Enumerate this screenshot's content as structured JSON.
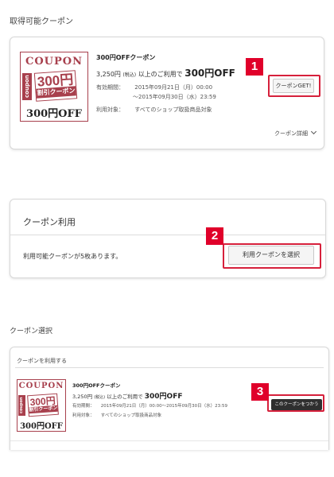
{
  "section1": {
    "title": "取得可能クーポン",
    "coupon": {
      "image": {
        "head": "COUPON",
        "side_tab": "coupon",
        "amount": "300円",
        "label": "割引クーポン",
        "foot": "300円OFF"
      },
      "name": "300円OFFクーポン",
      "condition_amount": "3,250円",
      "condition_tax": "(税込)",
      "condition_mid": "以上のご利用で",
      "condition_discount": "300円OFF",
      "period_label": "有効期間：",
      "period_start": "2015年09月21日（月）00:00",
      "period_end": "〜2015年09月30日（水）23:59",
      "target_label": "利用対象：",
      "target_value": "すべてのショップ取扱商品対象",
      "get_button": "クーポンGET!",
      "details_link": "クーポン詳細"
    },
    "step_badge": "1"
  },
  "section2": {
    "title": "クーポン利用",
    "available_text": "利用可能クーポンが5枚あります。",
    "select_button": "利用クーポンを選択",
    "step_badge": "2"
  },
  "section3": {
    "title": "クーポン選択",
    "subtitle": "クーポンを利用する",
    "coupon": {
      "image": {
        "head": "COUPON",
        "side_tab": "coupon",
        "amount": "300円",
        "label": "割引クーポン",
        "foot": "300円OFF"
      },
      "name": "300円OFFクーポン",
      "condition_amount": "3,250円",
      "condition_tax": "(税込)",
      "condition_mid": "以上のご利用で",
      "condition_discount": "300円OFF",
      "period_label": "有効期間：",
      "period_value": "2015年09月21日（月）00:00〜2015年09月30日（水）23:59",
      "target_label": "利用対象：",
      "target_value": "すべてのショップ取扱商品対象",
      "use_button": "このクーポンをつかう"
    },
    "step_badge": "3"
  },
  "colors": {
    "accent_red": "#e0002a",
    "coupon_maroon": "#a8404d",
    "dark_button": "#2f2f2f"
  },
  "icons": {
    "details_chevron": "chevron-down-icon"
  }
}
